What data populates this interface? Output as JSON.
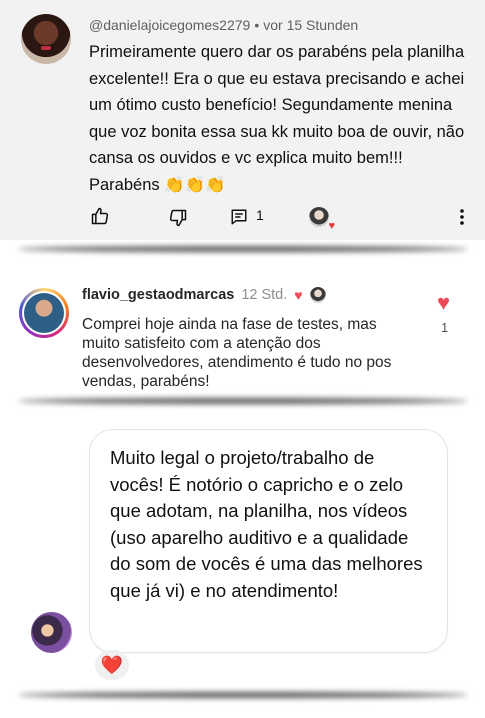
{
  "youtube_comment": {
    "username": "@danielajoicegomes2279",
    "separator": "•",
    "time": "vor 15 Stunden",
    "text": "Primeiramente quero dar os parabéns pela planilha excelente!!  Era o que eu estava precisando e achei um ótimo custo benefício! Segundamente menina que voz bonita essa sua kk muito boa de ouvir, não cansa os ouvidos e vc explica muito bem!!! Parabéns 👏👏👏",
    "reply_count": "1",
    "icons": [
      "thumbs-up-icon",
      "thumbs-down-icon",
      "reply-icon",
      "creator-heart-icon",
      "more-options-icon"
    ]
  },
  "instagram_comment": {
    "username": "flavio_gestaodmarcas",
    "time": "12 Std.",
    "text": "Comprei hoje ainda na fase de testes, mas muito satisfeito com a atenção dos desenvolvedores, atendimento é tudo no pos vendas, parabéns!",
    "like_count": "1",
    "heart_color": "#ed4956"
  },
  "message": {
    "text": "Muito legal o projeto/trabalho de vocês! É notório o capricho e o zelo que adotam, na planilha, nos vídeos (uso aparelho auditivo e a qualidade do som de vocês é uma das melhores que já vi) e no atendimento!",
    "reaction": "❤️"
  }
}
